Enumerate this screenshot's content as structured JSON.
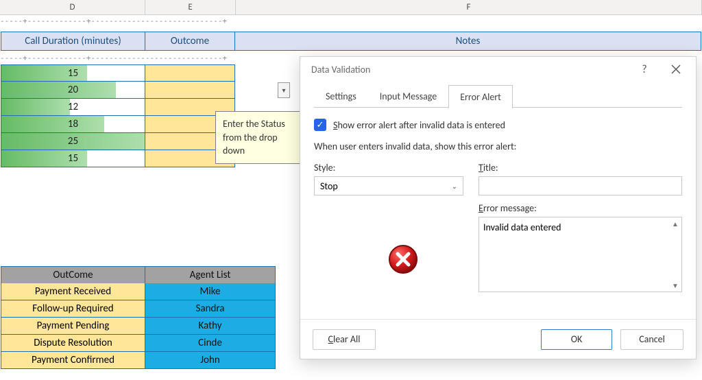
{
  "columns": {
    "D": "D",
    "E": "E",
    "F": "F"
  },
  "headers": {
    "callDuration": "Call Duration (minutes)",
    "outcome": "Outcome",
    "notes": "Notes"
  },
  "durations": [
    {
      "value": 15,
      "pct": 60
    },
    {
      "value": 20,
      "pct": 80
    },
    {
      "value": 12,
      "pct": 48
    },
    {
      "value": 18,
      "pct": 72
    },
    {
      "value": 25,
      "pct": 100
    },
    {
      "value": 15,
      "pct": 60
    }
  ],
  "tooltip": {
    "line1": "Enter the Status",
    "line2": "from the drop",
    "line3": "down"
  },
  "lowerHeaders": {
    "outcome": "OutCome",
    "agent": "Agent List"
  },
  "lowerRows": [
    {
      "a": "Payment Received",
      "b": "Mike"
    },
    {
      "a": "Follow-up Required",
      "b": "Sandra"
    },
    {
      "a": "Payment Pending",
      "b": "Kathy"
    },
    {
      "a": "Dispute Resolution",
      "b": "Cinde"
    },
    {
      "a": "Payment Confirmed",
      "b": "John"
    }
  ],
  "dialog": {
    "title": "Data Validation",
    "helpGlyph": "?",
    "closeGlyph": "×",
    "tabs": {
      "settings": "Settings",
      "inputMessage": "Input Message",
      "errorAlert": "Error Alert"
    },
    "showAlertPrefix": "S",
    "showAlertRest": "how error alert after invalid data is entered",
    "instruction": "When user enters invalid data, show this error alert:",
    "styleLabel": "Style:",
    "styleValue": "Stop",
    "titleLabelU": "T",
    "titleLabelRest": "itle:",
    "titleValue": "",
    "errorMsgLabelU": "E",
    "errorMsgLabelRest": "rror message:",
    "errorMsgValue": "Invalid data entered",
    "clearAllU": "C",
    "clearAllRest": "lear All",
    "ok": "OK",
    "cancel": "Cancel"
  }
}
